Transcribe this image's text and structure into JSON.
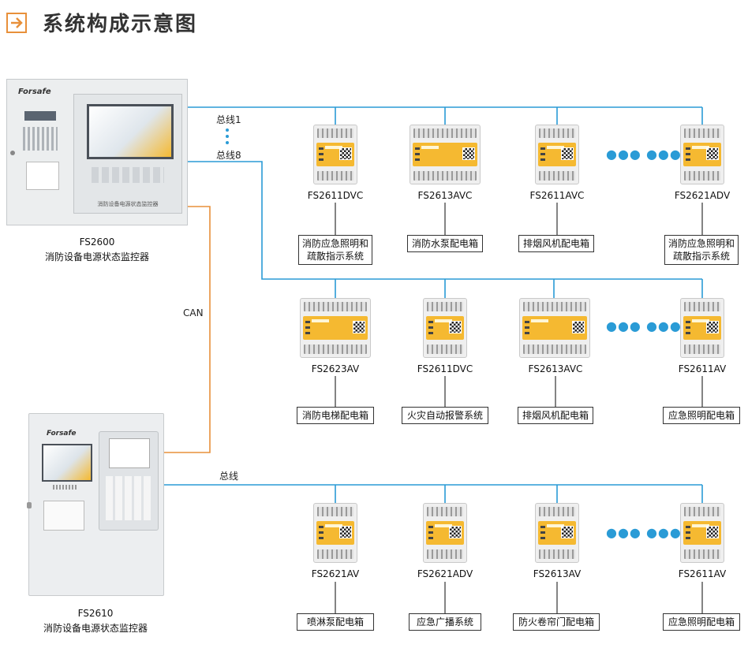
{
  "title": "系统构成示意图",
  "devices": {
    "top": {
      "model": "FS2600",
      "name": "消防设备电源状态监控器",
      "brand": "Forsafe",
      "front_label": "消防设备电源状态监控器"
    },
    "bottom": {
      "model": "FS2610",
      "name": "消防设备电源状态监控器",
      "brand": "Forsafe"
    }
  },
  "connections": {
    "bus1": "总线1",
    "bus8": "总线8",
    "can": "CAN",
    "bus": "总线"
  },
  "rows": [
    {
      "modules": [
        {
          "model": "FS2611DVC",
          "label": [
            "消防应急照明和",
            "疏散指示系统"
          ]
        },
        {
          "model": "FS2613AVC",
          "label": [
            "消防水泵配电箱"
          ]
        },
        {
          "model": "FS2611AVC",
          "label": [
            "排烟风机配电箱"
          ]
        },
        {
          "model": "FS2621ADV",
          "label": [
            "消防应急照明和",
            "疏散指示系统"
          ]
        }
      ]
    },
    {
      "modules": [
        {
          "model": "FS2623AV",
          "label": [
            "消防电梯配电箱"
          ]
        },
        {
          "model": "FS2611DVC",
          "label": [
            "火灾自动报警系统"
          ]
        },
        {
          "model": "FS2613AVC",
          "label": [
            "排烟风机配电箱"
          ]
        },
        {
          "model": "FS2611AV",
          "label": [
            "应急照明配电箱"
          ]
        }
      ]
    },
    {
      "modules": [
        {
          "model": "FS2621AV",
          "label": [
            "喷淋泵配电箱"
          ]
        },
        {
          "model": "FS2621ADV",
          "label": [
            "应急广播系统"
          ]
        },
        {
          "model": "FS2613AV",
          "label": [
            "防火卷帘门配电箱"
          ]
        },
        {
          "model": "FS2611AV",
          "label": [
            "应急照明配电箱"
          ]
        }
      ]
    }
  ],
  "ellipsis": "●●● ●●●",
  "colors": {
    "bus_line": "#2a9bd6",
    "can_line": "#e8903a",
    "module_face": "#f5b931",
    "title_icon": "#e8903a"
  }
}
